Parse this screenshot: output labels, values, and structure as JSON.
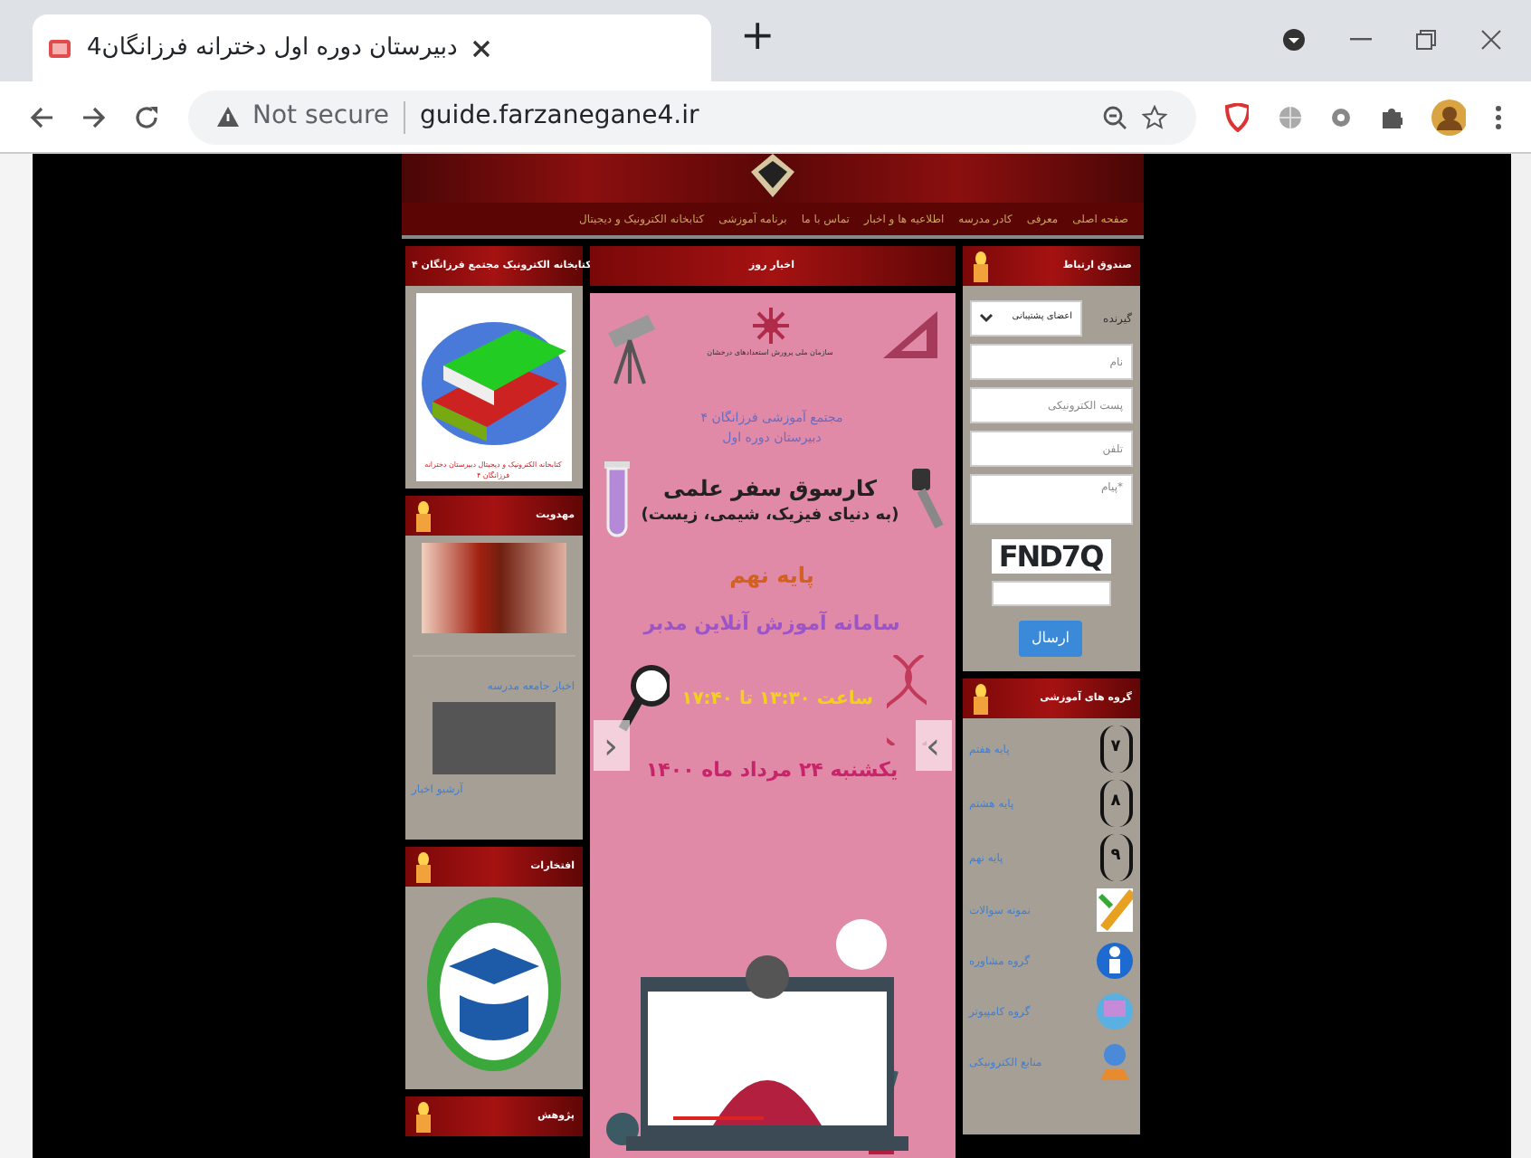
{
  "browser": {
    "tab_title": "دبیرستان دوره اول دخترانه فرزانگان4",
    "new_tab": "+",
    "security": "Not secure",
    "url": "guide.farzanegane4.ir"
  },
  "site": {
    "menu": [
      "صفحه اصلی",
      "معرفی",
      "کادر مدرسه",
      "اطلاعیه ها و اخبار",
      "تماس با ما",
      "برنامه آموزشی",
      "کتابخانه الکترونیک و دیجیتال"
    ]
  },
  "left_column": [
    {
      "title": "کتابخانه الکترونیک مجتمع فرزانگان ۴",
      "kind": "books",
      "caption": "کتابخانه الکترونیک و دیجیتال دبیرستان دخترانه فرزانگان ۴"
    },
    {
      "title": "مهدویت",
      "kind": "news",
      "links": [
        "اخبار جامعه مدرسه",
        "آرشیو اخبار"
      ]
    },
    {
      "title": "افتخارات",
      "kind": "logo"
    },
    {
      "title": "پژوهش",
      "kind": "empty"
    }
  ],
  "center": {
    "title": "اخبار روز",
    "poster": {
      "org": "سازمان ملی پرورش استعدادهای درخشان",
      "school": "مجتمع آموزشی فرزانگان ۴",
      "school_sub": "دبیرستان دوره اول",
      "headline": "کارسوق سفر علمی",
      "subhead": "(به دنیای فیزیک، شیمی، زیست)",
      "grade": "پایه نهم",
      "system": "سامانه آموزش آنلاین مدبر",
      "time": "ساعت ۱۳:۳۰ تا ۱۷:۴۰",
      "date": "یکشنبه ۲۴ مرداد ماه ۱۴۰۰"
    },
    "prev": "‹",
    "next": "›"
  },
  "contact": {
    "title": "صندوق ارتباط",
    "recipient_label": "گیرنده",
    "recipient": "اعضای پشتیبانی",
    "fields": [
      {
        "placeholder": "نام"
      },
      {
        "placeholder": "پست الکترونیکی"
      },
      {
        "placeholder": "تلفن"
      },
      {
        "placeholder": "*پیام",
        "kind": "textarea"
      }
    ],
    "captcha": "FND7Q",
    "submit": "ارسال"
  },
  "groups": {
    "title": "گروه های آموزشی",
    "items": [
      {
        "label": "پایه هفتم",
        "kind": "grade",
        "badge": "۷"
      },
      {
        "label": "پایه هشتم",
        "kind": "grade",
        "badge": "۸"
      },
      {
        "label": "پایه نهم",
        "kind": "grade",
        "badge": "۹"
      },
      {
        "label": "نمونه سوالات",
        "kind": "pencil"
      },
      {
        "label": "گروه مشاوره",
        "kind": "person"
      },
      {
        "label": "گروه کامپیوتر",
        "kind": "computer"
      },
      {
        "label": "منابع الکترونیکی",
        "kind": "user"
      }
    ]
  }
}
